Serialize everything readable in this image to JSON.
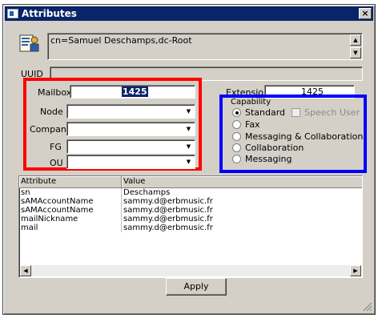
{
  "window": {
    "title": "Attributes",
    "close_glyph": "×",
    "icon": "window-app-icon"
  },
  "header": {
    "dn": "cn=Samuel Deschamps,dc-Root",
    "icon": "user-card-icon"
  },
  "uuid": {
    "label": "UUID",
    "value": ""
  },
  "mailbox": {
    "label": "Mailbox",
    "value": "1425"
  },
  "extension": {
    "label": "Extension",
    "value": "1425"
  },
  "fields": [
    {
      "label": "Node",
      "value": ""
    },
    {
      "label": "Company",
      "value": ""
    },
    {
      "label": "FG",
      "value": ""
    },
    {
      "label": "OU",
      "value": ""
    }
  ],
  "capability": {
    "legend": "Capability",
    "options": [
      "Standard",
      "Fax",
      "Messaging & Collaboration",
      "Collaboration",
      "Messaging"
    ],
    "selected": "Standard",
    "speech_user": "Speech User"
  },
  "attributes_table": {
    "headers": [
      "Attribute",
      "Value"
    ],
    "rows": [
      [
        "sn",
        "Deschamps"
      ],
      [
        "sAMAccountName",
        "sammy.d@erbmusic.fr"
      ],
      [
        "sAMAccountName",
        "sammy.d@erbmusic.fr"
      ],
      [
        "mailNickname",
        "sammy.d@erbmusic.fr"
      ],
      [
        "mail",
        "sammy.d@erbmusic.fr"
      ]
    ]
  },
  "apply_label": "Apply",
  "highlight_colors": {
    "red": "#ff0000",
    "blue": "#0000ff"
  }
}
